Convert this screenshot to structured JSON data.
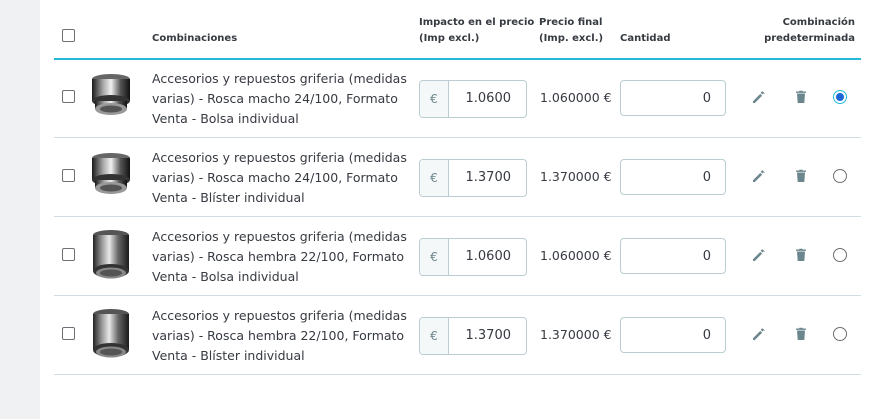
{
  "header": {
    "combinations": "Combinaciones",
    "price_impact_line1": "Impacto en el precio",
    "price_impact_line2": "(Imp excl.)",
    "final_price_line1": "Precio final",
    "final_price_line2": "(Imp. excl.)",
    "quantity": "Cantidad",
    "default_line1": "Combinación",
    "default_line2": "predeterminada"
  },
  "currency_symbol": "€",
  "rows": [
    {
      "name_line1": "Accesorios y repuestos griferia (medidas",
      "name_line2": "varias) - Rosca macho 24/100, Formato",
      "name_line3": "Venta - Bolsa individual",
      "price_impact": "1.0600",
      "final_price": "1.060000 €",
      "quantity": "0",
      "thumb": "aerator-male-thread",
      "is_default": true
    },
    {
      "name_line1": "Accesorios y repuestos griferia (medidas",
      "name_line2": "varias) - Rosca macho 24/100, Formato",
      "name_line3": "Venta - Blíster individual",
      "price_impact": "1.3700",
      "final_price": "1.370000 €",
      "quantity": "0",
      "thumb": "aerator-male-thread",
      "is_default": false
    },
    {
      "name_line1": "Accesorios y repuestos griferia (medidas",
      "name_line2": "varias) - Rosca hembra 22/100, Formato",
      "name_line3": "Venta - Bolsa individual",
      "price_impact": "1.0600",
      "final_price": "1.060000 €",
      "quantity": "0",
      "thumb": "aerator-female-thread",
      "is_default": false
    },
    {
      "name_line1": "Accesorios y repuestos griferia (medidas",
      "name_line2": "varias) - Rosca hembra 22/100, Formato",
      "name_line3": "Venta - Blíster individual",
      "price_impact": "1.3700",
      "final_price": "1.370000 €",
      "quantity": "0",
      "thumb": "aerator-female-thread",
      "is_default": false
    }
  ],
  "colors": {
    "accent": "#25b9d7",
    "radio_selected": "#1e66d6",
    "icon": "#6c868e",
    "row_border": "#cfdfe3"
  },
  "icons": {
    "edit": "pencil-icon",
    "delete": "trash-icon"
  }
}
